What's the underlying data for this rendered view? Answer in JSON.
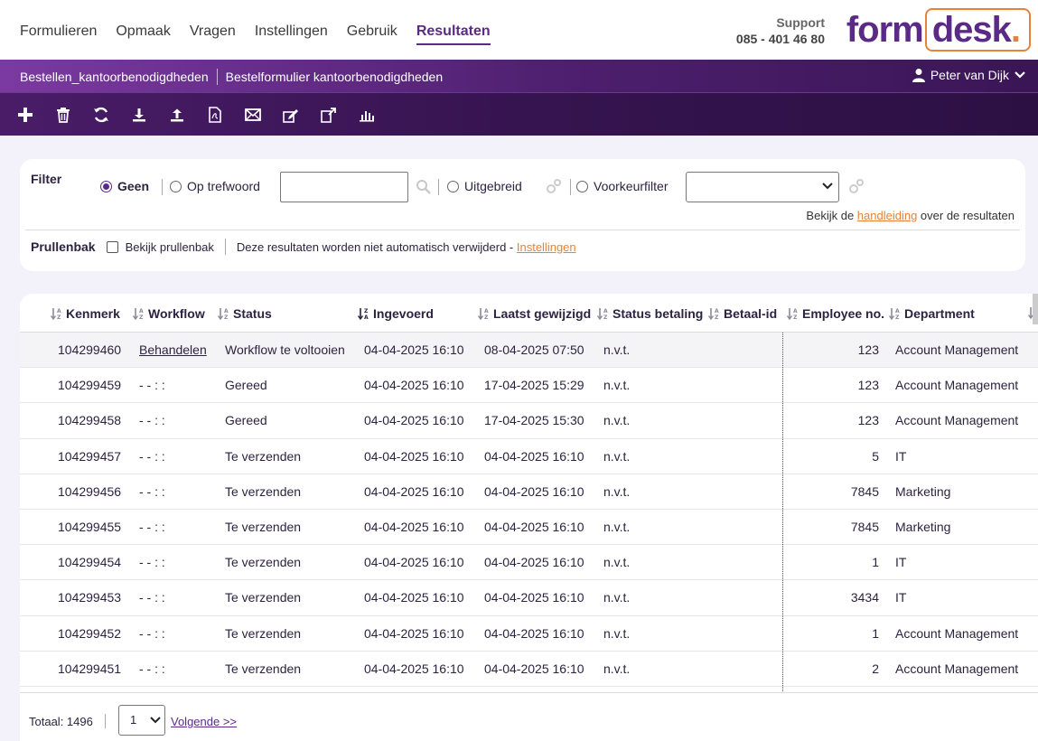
{
  "nav": {
    "items": [
      {
        "label": "Formulieren",
        "active": false
      },
      {
        "label": "Opmaak",
        "active": false
      },
      {
        "label": "Vragen",
        "active": false
      },
      {
        "label": "Instellingen",
        "active": false
      },
      {
        "label": "Gebruik",
        "active": false
      },
      {
        "label": "Resultaten",
        "active": true
      }
    ]
  },
  "support": {
    "label": "Support",
    "phone": "085 - 401 46 80"
  },
  "logo": {
    "part1": "form",
    "part2": "desk",
    "dot": "."
  },
  "breadcrumb": {
    "item1": "Bestellen_kantoorbenodigdheden",
    "item2": "Bestelformulier kantoorbenodigdheden"
  },
  "user": {
    "name": "Peter van Dijk"
  },
  "toolbar": {
    "icons": [
      "plus-icon",
      "trash-icon",
      "refresh-icon",
      "download-icon",
      "upload-icon",
      "pdf-icon",
      "mail-icon",
      "edit-icon",
      "export-icon",
      "chart-icon"
    ]
  },
  "filter": {
    "label": "Filter",
    "opt_none": "Geen",
    "opt_keyword": "Op trefwoord",
    "keyword_value": "",
    "opt_extended": "Uitgebreid",
    "opt_preference": "Voorkeurfilter",
    "preference_value": "",
    "help_prefix": "Bekijk de ",
    "help_link": "handleiding",
    "help_suffix": " over de resultaten",
    "trash_label": "Prullenbak",
    "trash_checkbox": "Bekijk prullenbak",
    "trash_note": "Deze resultaten worden niet automatisch verwijderd - ",
    "trash_link": "Instellingen"
  },
  "table": {
    "columns": {
      "kenmerk": "Kenmerk",
      "workflow": "Workflow",
      "status": "Status",
      "ingevoerd": "Ingevoerd",
      "gewijzigd": "Laatst gewijzigd",
      "betaling": "Status betaling",
      "betaalid": "Betaal-id",
      "employee": "Employee no.",
      "department": "Department"
    },
    "rows": [
      {
        "kenmerk": "104299460",
        "workflow": "Behandelen",
        "workflow_link": true,
        "status": "Workflow te voltooien",
        "ingevoerd": "04-04-2025 16:10",
        "gewijzigd": "08-04-2025 07:50",
        "betaling": "n.v.t.",
        "betaalid": "",
        "employee": "123",
        "department": "Account Management"
      },
      {
        "kenmerk": "104299459",
        "workflow": "- - : :",
        "workflow_link": false,
        "status": "Gereed",
        "ingevoerd": "04-04-2025 16:10",
        "gewijzigd": "17-04-2025 15:29",
        "betaling": "n.v.t.",
        "betaalid": "",
        "employee": "123",
        "department": "Account Management"
      },
      {
        "kenmerk": "104299458",
        "workflow": "- - : :",
        "workflow_link": false,
        "status": "Gereed",
        "ingevoerd": "04-04-2025 16:10",
        "gewijzigd": "17-04-2025 15:30",
        "betaling": "n.v.t.",
        "betaalid": "",
        "employee": "123",
        "department": "Account Management"
      },
      {
        "kenmerk": "104299457",
        "workflow": "- - : :",
        "workflow_link": false,
        "status": "Te verzenden",
        "ingevoerd": "04-04-2025 16:10",
        "gewijzigd": "04-04-2025 16:10",
        "betaling": "n.v.t.",
        "betaalid": "",
        "employee": "5",
        "department": "IT"
      },
      {
        "kenmerk": "104299456",
        "workflow": "- - : :",
        "workflow_link": false,
        "status": "Te verzenden",
        "ingevoerd": "04-04-2025 16:10",
        "gewijzigd": "04-04-2025 16:10",
        "betaling": "n.v.t.",
        "betaalid": "",
        "employee": "7845",
        "department": "Marketing"
      },
      {
        "kenmerk": "104299455",
        "workflow": "- - : :",
        "workflow_link": false,
        "status": "Te verzenden",
        "ingevoerd": "04-04-2025 16:10",
        "gewijzigd": "04-04-2025 16:10",
        "betaling": "n.v.t.",
        "betaalid": "",
        "employee": "7845",
        "department": "Marketing"
      },
      {
        "kenmerk": "104299454",
        "workflow": "- - : :",
        "workflow_link": false,
        "status": "Te verzenden",
        "ingevoerd": "04-04-2025 16:10",
        "gewijzigd": "04-04-2025 16:10",
        "betaling": "n.v.t.",
        "betaalid": "",
        "employee": "1",
        "department": "IT"
      },
      {
        "kenmerk": "104299453",
        "workflow": "- - : :",
        "workflow_link": false,
        "status": "Te verzenden",
        "ingevoerd": "04-04-2025 16:10",
        "gewijzigd": "04-04-2025 16:10",
        "betaling": "n.v.t.",
        "betaalid": "",
        "employee": "3434",
        "department": "IT"
      },
      {
        "kenmerk": "104299452",
        "workflow": "- - : :",
        "workflow_link": false,
        "status": "Te verzenden",
        "ingevoerd": "04-04-2025 16:10",
        "gewijzigd": "04-04-2025 16:10",
        "betaling": "n.v.t.",
        "betaalid": "",
        "employee": "1",
        "department": "Account Management"
      },
      {
        "kenmerk": "104299451",
        "workflow": "- - : :",
        "workflow_link": false,
        "status": "Te verzenden",
        "ingevoerd": "04-04-2025 16:10",
        "gewijzigd": "04-04-2025 16:10",
        "betaling": "n.v.t.",
        "betaalid": "",
        "employee": "2",
        "department": "Account Management"
      }
    ]
  },
  "footer": {
    "total": "Totaal: 1496",
    "page_value": "1",
    "next_label": "Volgende >>"
  },
  "colors": {
    "brand_purple": "#5b2a86",
    "accent_orange": "#e8823a"
  }
}
